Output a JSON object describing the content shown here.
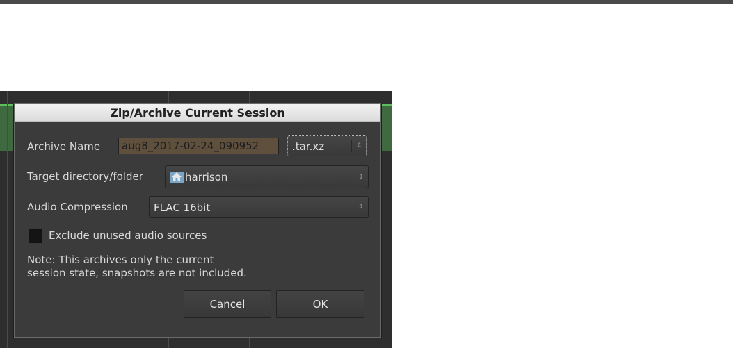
{
  "dialog": {
    "title": "Zip/Archive Current Session",
    "archive_name_label": "Archive Name",
    "archive_name_value": "aug8_2017-02-24_090952",
    "format_value": ".tar.xz",
    "target_dir_label": "Target directory/folder",
    "target_dir_value": "harrison",
    "audio_compression_label": "Audio Compression",
    "audio_compression_value": "FLAC 16bit",
    "exclude_label": "Exclude unused audio sources",
    "exclude_checked": false,
    "note_line1": "Note: This archives only the current",
    "note_line2": "session state, snapshots are not included.",
    "cancel_label": "Cancel",
    "ok_label": "OK"
  },
  "icons": {
    "home": "home-folder-icon",
    "dropdown": "chevron-updown-icon"
  },
  "colors": {
    "dialog_bg": "#3b3b3b",
    "entry_bg": "#5e503d",
    "track_green": "#3f6a3f"
  }
}
